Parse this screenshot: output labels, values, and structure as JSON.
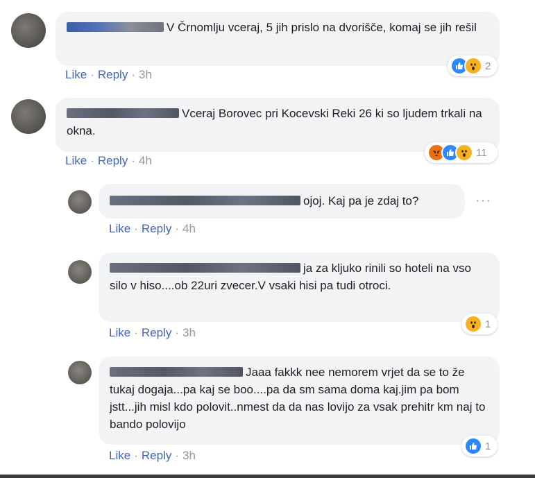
{
  "labels": {
    "like": "Like",
    "reply": "Reply",
    "dot": "·"
  },
  "comments": [
    {
      "text": "V Črnomlju vceraj, 5 jih prislo na dvorišče, komaj se jih rešil",
      "time": "3h",
      "reaction_count": "2",
      "reactions": [
        "like-icon",
        "wow-icon"
      ]
    },
    {
      "text": "Vceraj Borovec pri Kocevski Reki 26 ki so ljudem trkali na okna.",
      "time": "4h",
      "reaction_count": "11",
      "reactions": [
        "angry-icon",
        "like-icon",
        "wow-icon"
      ]
    }
  ],
  "replies": [
    {
      "text": "ojoj. Kaj pa je zdaj to?",
      "time": "4h",
      "more": "···"
    },
    {
      "text": "ja za kljuko rinili so hoteli na vso silo v hiso....ob 22uri zvecer.V vsaki hisi pa tudi otroci.",
      "time": "3h",
      "reaction_count": "1",
      "reactions": [
        "wow-icon"
      ]
    },
    {
      "text": "Jaaa fakkk nee nemorem vrjet da se to že tukaj dogaja...pa kaj se boo....pa da sm sama doma kaj.jim pa bom jstt...jih misl kdo polovit..nmest da da nas lovijo za vsak prehitr km naj to bando polovijo",
      "time": "3h",
      "reaction_count": "1",
      "reactions": [
        "like-icon"
      ]
    }
  ],
  "colors": {
    "link": "#4267b2",
    "meta": "#9197a3",
    "bubble": "#f2f3f5",
    "like": "#2d88ff",
    "wow": "#f7b125",
    "angry": "#e9710f"
  }
}
